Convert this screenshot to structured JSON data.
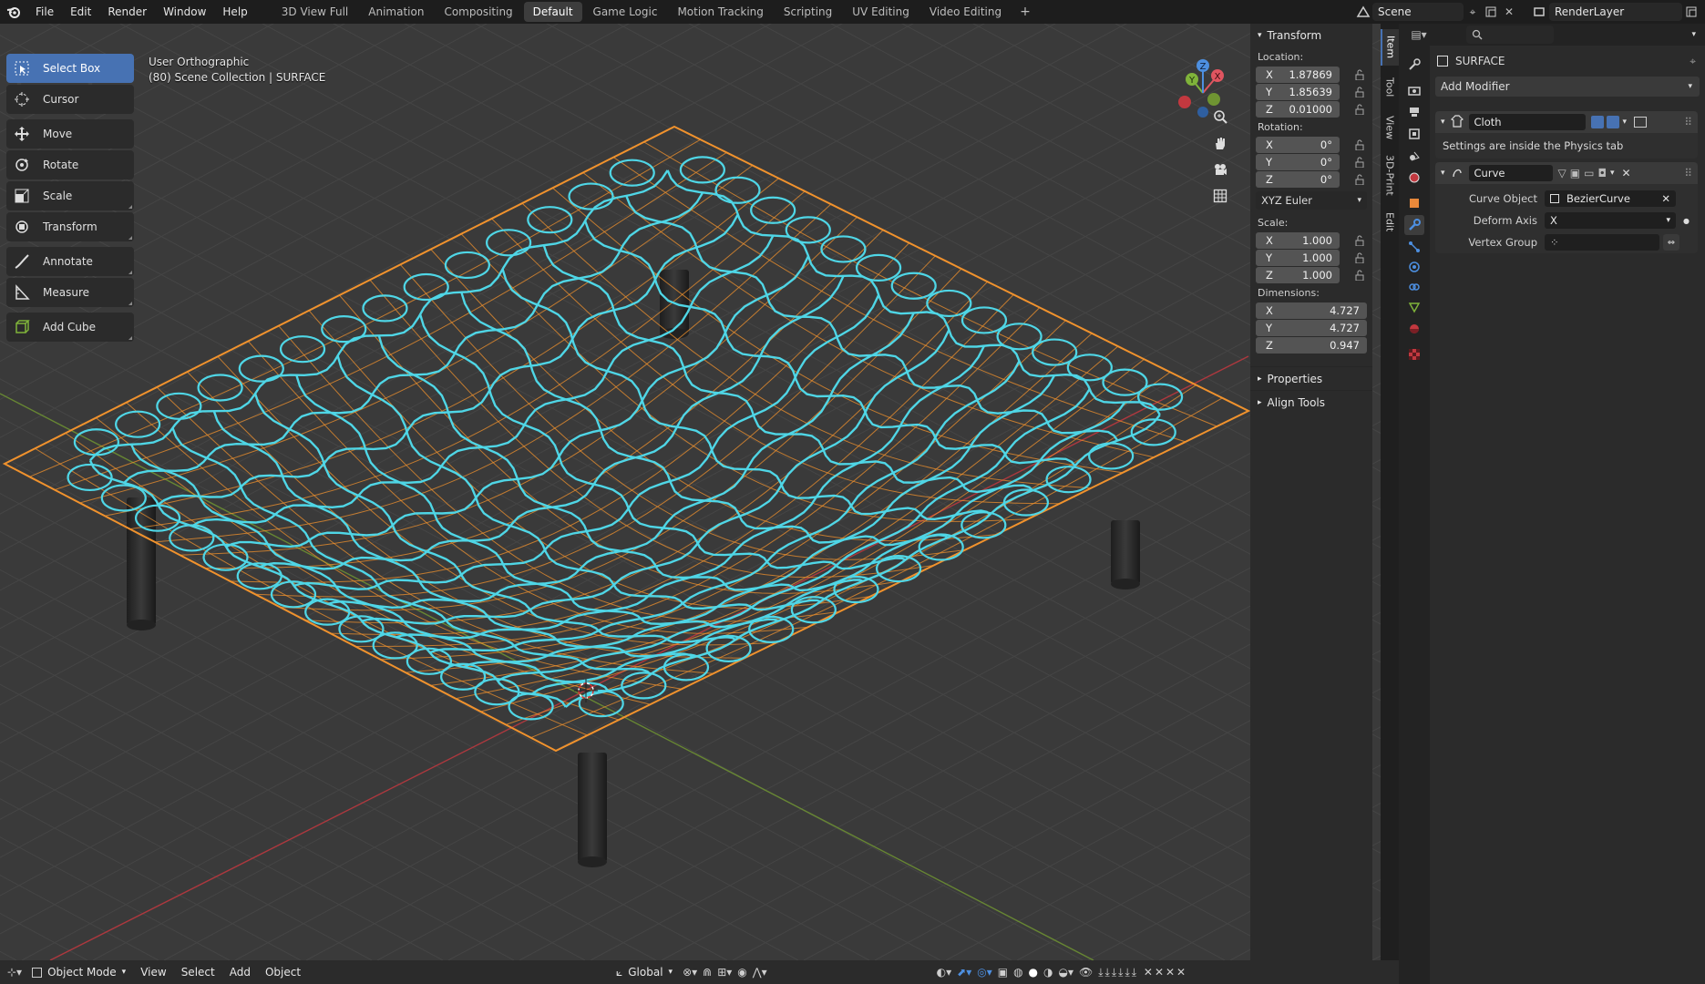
{
  "topbar": {
    "menus": [
      "File",
      "Edit",
      "Render",
      "Window",
      "Help"
    ],
    "workspaces": [
      "3D View Full",
      "Animation",
      "Compositing",
      "Default",
      "Game Logic",
      "Motion Tracking",
      "Scripting",
      "UV Editing",
      "Video Editing"
    ],
    "active_workspace": "Default",
    "add_tab": "+",
    "scene_name": "Scene",
    "render_layer": "RenderLayer"
  },
  "toolbar": {
    "tools": [
      {
        "label": "Select Box",
        "icon": "select-box-icon",
        "active": true
      },
      {
        "label": "Cursor",
        "icon": "cursor-icon"
      },
      {
        "label": "Move",
        "icon": "move-icon"
      },
      {
        "label": "Rotate",
        "icon": "rotate-icon"
      },
      {
        "label": "Scale",
        "icon": "scale-icon"
      },
      {
        "label": "Transform",
        "icon": "transform-icon"
      },
      {
        "label": "Annotate",
        "icon": "annotate-icon"
      },
      {
        "label": "Measure",
        "icon": "measure-icon"
      },
      {
        "label": "Add Cube",
        "icon": "add-cube-icon"
      }
    ]
  },
  "viewport": {
    "view_name": "User Orthographic",
    "collection_info": "(80) Scene Collection | SURFACE"
  },
  "npanel": {
    "section": "Transform",
    "location_label": "Location:",
    "location": {
      "x": "1.87869",
      "y": "1.85639",
      "z": "0.01000"
    },
    "rotation_label": "Rotation:",
    "rotation": {
      "x": "0°",
      "y": "0°",
      "z": "0°"
    },
    "rotation_mode": "XYZ Euler",
    "scale_label": "Scale:",
    "scale": {
      "x": "1.000",
      "y": "1.000",
      "z": "1.000"
    },
    "dimensions_label": "Dimensions:",
    "dimensions": {
      "x": "4.727",
      "y": "4.727",
      "z": "0.947"
    },
    "axis_labels": {
      "x": "X",
      "y": "Y",
      "z": "Z"
    },
    "properties_label": "Properties",
    "align_tools_label": "Align Tools",
    "tabs": [
      "Item",
      "Tool",
      "View",
      "3D-Print",
      "Edit"
    ]
  },
  "bottombar": {
    "mode": "Object Mode",
    "menus": [
      "View",
      "Select",
      "Add",
      "Object"
    ],
    "orientation": "Global"
  },
  "properties": {
    "object_name": "SURFACE",
    "add_modifier": "Add Modifier",
    "cloth_modifier": {
      "name": "Cloth",
      "note": "Settings are inside the Physics tab"
    },
    "curve_modifier": {
      "name": "Curve",
      "curve_object_label": "Curve Object",
      "curve_object_value": "BezierCurve",
      "deform_axis_label": "Deform Axis",
      "deform_axis_value": "X",
      "vertex_group_label": "Vertex Group"
    }
  },
  "colors": {
    "accent": "#4772b3",
    "selection_orange": "#f0922d",
    "net_cyan": "#4fd6e6",
    "axis_red": "#c2383f",
    "axis_green": "#6f9432"
  }
}
